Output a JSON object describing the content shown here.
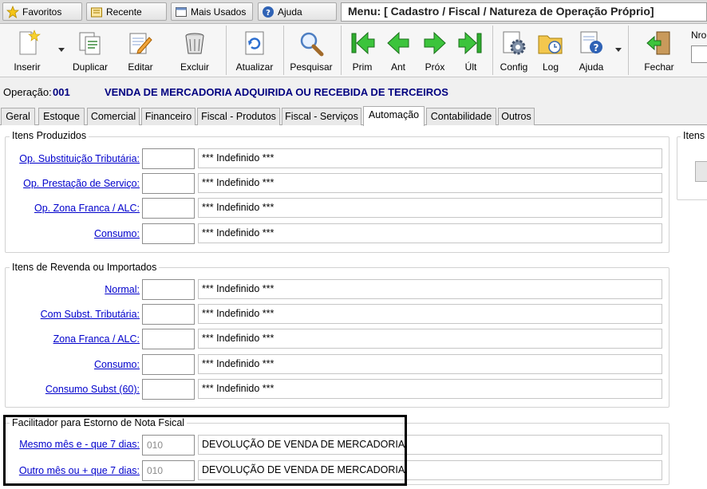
{
  "quickbar": {
    "favoritos": "Favoritos",
    "recente": "Recente",
    "mais_usados": "Mais Usados",
    "ajuda": "Ajuda",
    "menu_path": "Menu: [ Cadastro / Fiscal / Natureza de Operação Próprio]"
  },
  "toolbar": {
    "inserir": "Inserir",
    "duplicar": "Duplicar",
    "editar": "Editar",
    "excluir": "Excluir",
    "atualizar": "Atualizar",
    "pesquisar": "Pesquisar",
    "prim": "Prim",
    "ant": "Ant",
    "prox": "Próx",
    "ult": "Últ",
    "config": "Config",
    "log": "Log",
    "ajuda": "Ajuda",
    "fechar": "Fechar",
    "nro_label": "Nro"
  },
  "operation": {
    "label": "Operação:",
    "code": "001",
    "description": "VENDA DE MERCADORIA ADQUIRIDA OU RECEBIDA DE TERCEIROS"
  },
  "tabs": [
    {
      "label": "Geral"
    },
    {
      "label": "Estoque"
    },
    {
      "label": "Comercial"
    },
    {
      "label": "Financeiro"
    },
    {
      "label": "Fiscal - Produtos"
    },
    {
      "label": "Fiscal - Serviços"
    },
    {
      "label": "Automação"
    },
    {
      "label": "Contabilidade"
    },
    {
      "label": "Outros"
    }
  ],
  "active_tab": "Automação",
  "itens_produzidos": {
    "title": "Itens Produzidos",
    "rows": [
      {
        "label": "Op. Substituição Tributária:",
        "code": "",
        "desc": "*** Indefinido ***"
      },
      {
        "label": "Op. Prestação de Serviço:",
        "code": "",
        "desc": "*** Indefinido ***"
      },
      {
        "label": "Op. Zona Franca / ALC:",
        "code": "",
        "desc": "*** Indefinido ***"
      },
      {
        "label": "Consumo:",
        "code": "",
        "desc": "*** Indefinido ***"
      }
    ]
  },
  "itens_revenda": {
    "title": "Itens de Revenda ou Importados",
    "rows": [
      {
        "label": "Normal:",
        "code": "",
        "desc": "*** Indefinido ***"
      },
      {
        "label": "Com Subst. Tributária:",
        "code": "",
        "desc": "*** Indefinido ***"
      },
      {
        "label": "Zona Franca / ALC:",
        "code": "",
        "desc": "*** Indefinido ***"
      },
      {
        "label": "Consumo:",
        "code": "",
        "desc": "*** Indefinido ***"
      },
      {
        "label": "Consumo Subst (60):",
        "code": "",
        "desc": "*** Indefinido ***"
      }
    ]
  },
  "facilitador": {
    "title": "Facilitador para Estorno de Nota Fsical",
    "rows": [
      {
        "label": "Mesmo mês e - que 7 dias:",
        "code": "010",
        "desc": "DEVOLUÇÃO DE VENDA DE MERCADORIA"
      },
      {
        "label": "Outro mês ou + que 7 dias:",
        "code": "010",
        "desc": "DEVOLUÇÃO DE VENDA DE MERCADORIA"
      }
    ]
  },
  "right_group": {
    "title": "Itens"
  },
  "colors": {
    "link": "#0000cc",
    "operation_text": "#000080",
    "highlight_border": "#000000"
  }
}
